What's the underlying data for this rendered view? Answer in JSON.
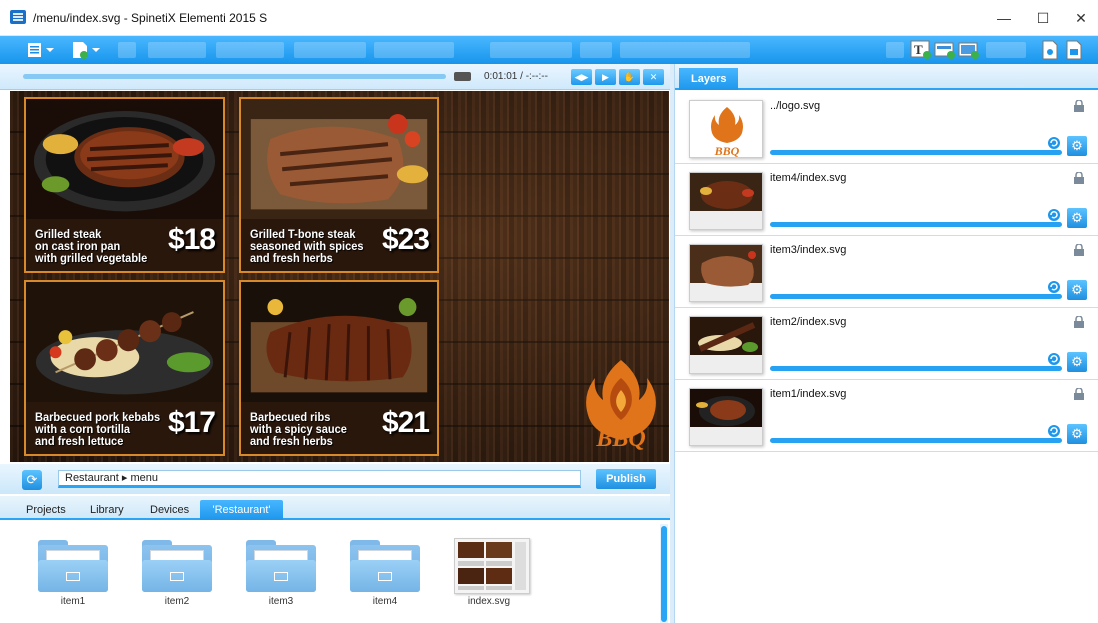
{
  "window": {
    "title": "/menu/index.svg - SpinetiX Elementi 2015 S"
  },
  "window_controls": {
    "minimize": "—",
    "maximize": "☐",
    "close": "✕"
  },
  "timeline": {
    "time": "0:01:01 / -:--:--",
    "buttons": [
      "◀▶",
      "▶",
      "✋",
      "✕"
    ]
  },
  "menu": {
    "items": [
      {
        "title_lines": [
          "Grilled steak",
          "on cast iron pan",
          "with grilled vegetable"
        ],
        "price": "$18"
      },
      {
        "title_lines": [
          "Grilled T-bone steak",
          "seasoned with spices",
          "and fresh herbs"
        ],
        "price": "$23"
      },
      {
        "title_lines": [
          "Barbecued pork kebabs",
          "with a corn tortilla",
          "and fresh lettuce"
        ],
        "price": "$17"
      },
      {
        "title_lines": [
          "Barbecued ribs",
          "with a spicy sauce",
          "and fresh herbs"
        ],
        "price": "$21"
      }
    ],
    "logo_text": "BBQ"
  },
  "pathbar": {
    "path": "Restaurant ▸ menu",
    "publish_label": "Publish",
    "refresh_icon": "⟳"
  },
  "tabs": [
    "Projects",
    "Library",
    "Devices",
    "'Restaurant'"
  ],
  "files": [
    {
      "label": "item1",
      "type": "folder"
    },
    {
      "label": "item2",
      "type": "folder"
    },
    {
      "label": "item3",
      "type": "folder"
    },
    {
      "label": "item4",
      "type": "folder"
    },
    {
      "label": "index.svg",
      "type": "svg"
    }
  ],
  "layers_panel": {
    "tab_label": "Layers",
    "layers": [
      {
        "name": "../logo.svg"
      },
      {
        "name": "item4/index.svg"
      },
      {
        "name": "item3/index.svg"
      },
      {
        "name": "item2/index.svg"
      },
      {
        "name": "item1/index.svg"
      }
    ],
    "gear_icon": "⚙"
  },
  "colors": {
    "accent": "#1d97ec",
    "card_border": "#d88a2a",
    "wood": "#3b2416"
  }
}
